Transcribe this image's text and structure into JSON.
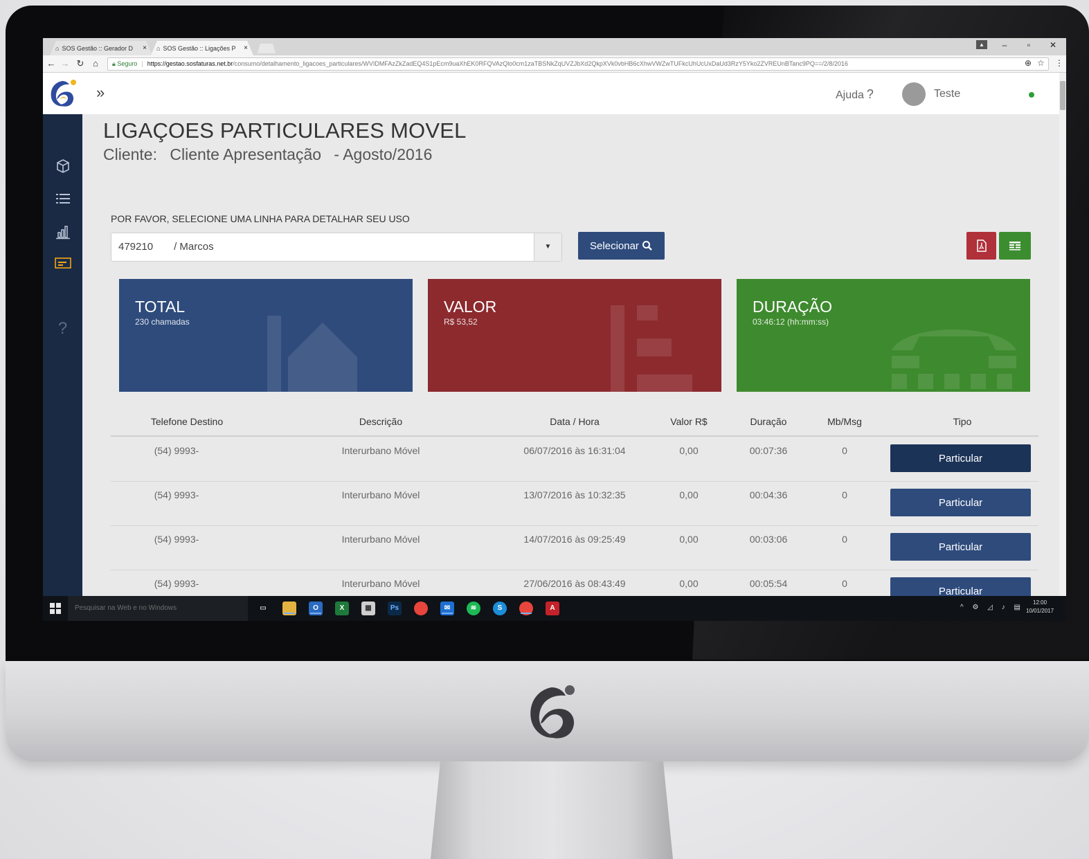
{
  "browser": {
    "tabs": [
      {
        "title": "SOS Gestão :: Gerador D",
        "active": false
      },
      {
        "title": "SOS Gestão :: Ligações P",
        "active": true
      }
    ],
    "secure_label": "Seguro",
    "url_host": "https://gestao.sosfaturas.net.br",
    "url_path": "/consumo/detalhamento_ligacoes_particulares/WVIDMFAzZkZadEQ4S1pEcm9uaXhEK0RFQVAzQlo0cm1zaTBSNkZqUVZJbXd2QkpXVk0vbHB6cXhwVWZwTUFkcUhUcUxDaUd3RzY5Yko2ZVREUnBTanc9PQ==/2/8/2016"
  },
  "header": {
    "help_label": "Ajuda",
    "help_q": "?",
    "user_name": "Teste"
  },
  "sidebar": {
    "items": [
      {
        "icon": "cube-icon"
      },
      {
        "icon": "list-icon"
      },
      {
        "icon": "bar-chart-icon"
      },
      {
        "icon": "card-icon",
        "active": true
      },
      {
        "icon": "help-icon",
        "label": "?"
      }
    ]
  },
  "page": {
    "title": "LIGAÇOES PARTICULARES MOVEL",
    "client_label": "Cliente:",
    "client_name": "Cliente Apresentação",
    "period": "- Agosto/2016",
    "instruction": "POR FAVOR, SELECIONE UMA LINHA PARA DETALHAR SEU USO"
  },
  "line_select": {
    "number": "479210",
    "name": "/ Marcos",
    "button_label": "Selecionar"
  },
  "cards": {
    "total": {
      "title": "TOTAL",
      "value": "230 chamadas",
      "color": "#2e4b7c"
    },
    "valor": {
      "title": "VALOR",
      "value": "R$ 53,52",
      "color": "#8c2a2e"
    },
    "duracao": {
      "title": "DURAÇÃO",
      "value": "03:46:12 (hh:mm:ss)",
      "color": "#3e8a2e"
    }
  },
  "table": {
    "headers": [
      "Telefone Destino",
      "Descrição",
      "Data / Hora",
      "Valor R$",
      "Duração",
      "Mb/Msg",
      "Tipo"
    ],
    "rows": [
      {
        "phone": "(54) 9993-",
        "desc": "Interurbano Móvel",
        "datetime": "06/07/2016 às 16:31:04",
        "valor": "0,00",
        "duracao": "00:07:36",
        "mb": "0",
        "tipo": "Particular"
      },
      {
        "phone": "(54) 9993-",
        "desc": "Interurbano Móvel",
        "datetime": "13/07/2016 às 10:32:35",
        "valor": "0,00",
        "duracao": "00:04:36",
        "mb": "0",
        "tipo": "Particular"
      },
      {
        "phone": "(54) 9993-",
        "desc": "Interurbano Móvel",
        "datetime": "14/07/2016 às 09:25:49",
        "valor": "0,00",
        "duracao": "00:03:06",
        "mb": "0",
        "tipo": "Particular"
      },
      {
        "phone": "(54) 9993-",
        "desc": "Interurbano Móvel",
        "datetime": "27/06/2016 às 08:43:49",
        "valor": "0,00",
        "duracao": "00:05:54",
        "mb": "0",
        "tipo": "Particular"
      }
    ]
  },
  "taskbar": {
    "search_placeholder": "Pesquisar na Web e no Windows",
    "time": "12:00",
    "date": "10/01/2017"
  },
  "colors": {
    "brand_blue": "#2e4b7c",
    "brand_red": "#8c2a2e",
    "brand_green": "#3e8a2e",
    "sidebar_bg": "#1a2a44"
  }
}
